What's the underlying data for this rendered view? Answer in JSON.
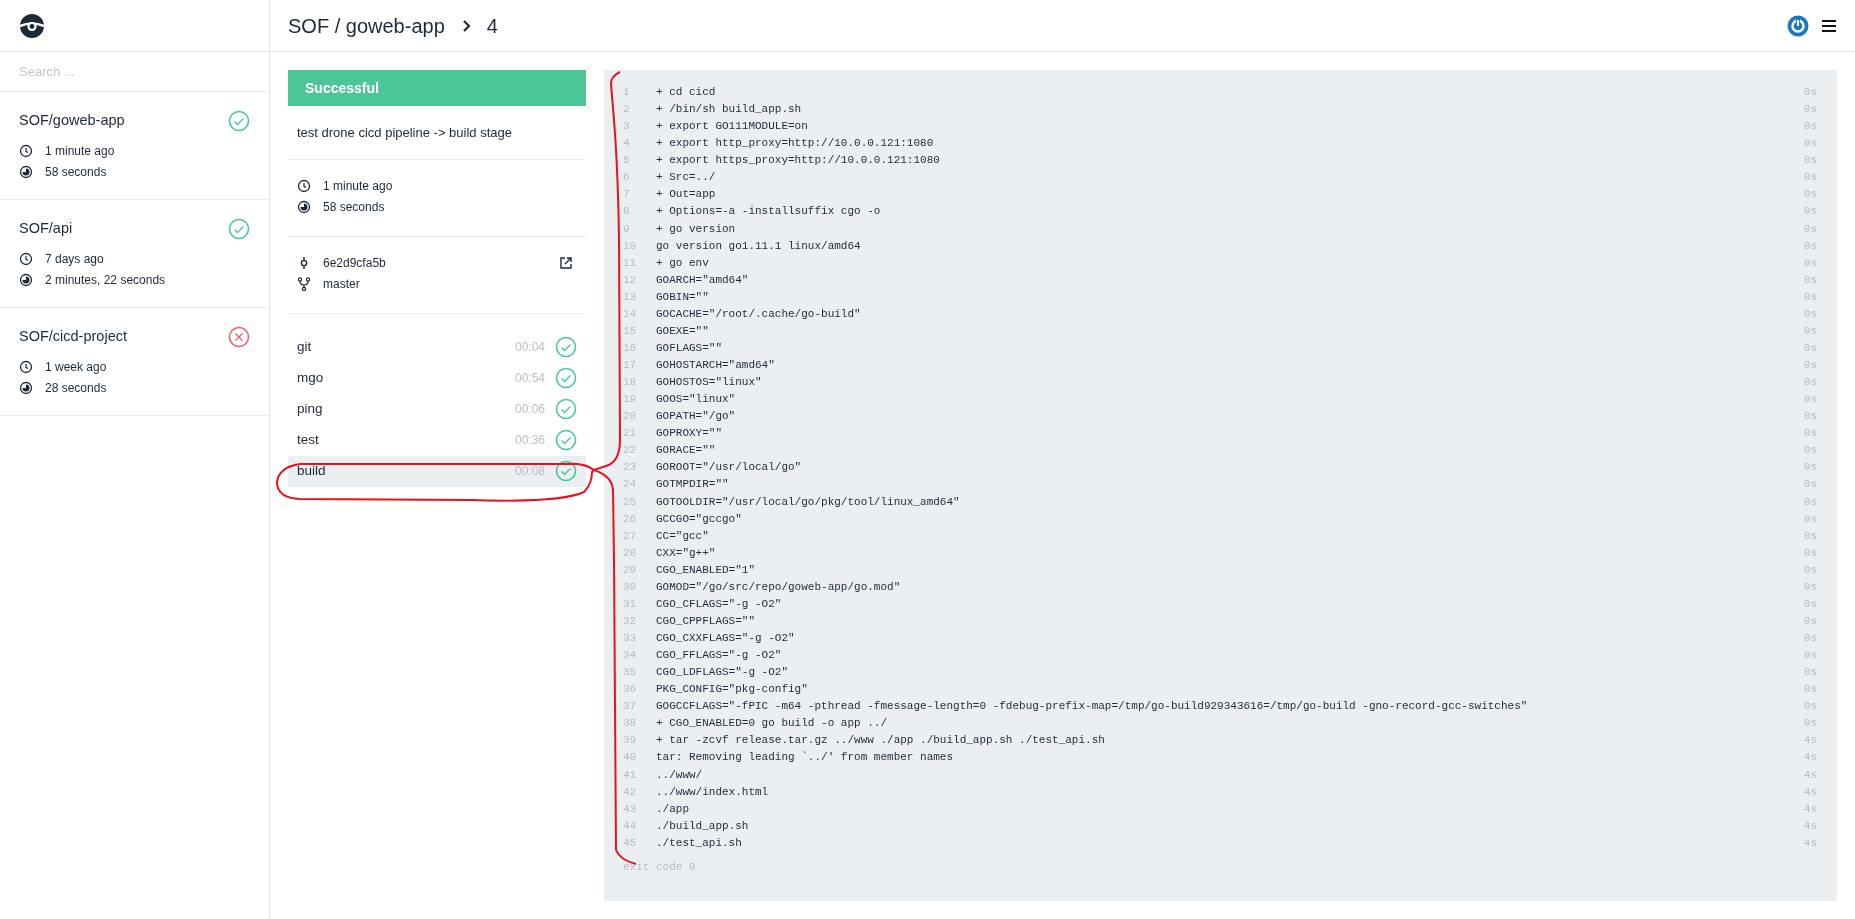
{
  "search": {
    "placeholder": "Search ..."
  },
  "repos": [
    {
      "name": "SOF/goweb-app",
      "kind": "success",
      "created": "1 minute ago",
      "duration": "58 seconds"
    },
    {
      "name": "SOF/api",
      "kind": "success",
      "created": "7 days ago",
      "duration": "2 minutes, 22 seconds"
    },
    {
      "name": "SOF/cicd-project",
      "kind": "failure",
      "created": "1 week ago",
      "duration": "28 seconds"
    }
  ],
  "header": {
    "breadcrumb": "SOF / goweb-app",
    "build_number": "4"
  },
  "build": {
    "kind": "success",
    "status_label": "Successful",
    "message": "test drone cicd pipeline -> build stage",
    "created": "1 minute ago",
    "duration": "58 seconds",
    "commit": "6e2d9cfa5b",
    "branch": "master"
  },
  "steps": [
    {
      "name": "git",
      "duration": "00:04",
      "kind": "success",
      "selected": false
    },
    {
      "name": "mgo",
      "duration": "00:54",
      "kind": "success",
      "selected": false
    },
    {
      "name": "ping",
      "duration": "00:06",
      "kind": "success",
      "selected": false
    },
    {
      "name": "test",
      "duration": "00:36",
      "kind": "success",
      "selected": false
    },
    {
      "name": "build",
      "duration": "00:08",
      "kind": "success",
      "selected": true
    }
  ],
  "log": {
    "lines": [
      {
        "number": "1",
        "text": "+ cd cicd",
        "time": "0s"
      },
      {
        "number": "2",
        "text": "+ /bin/sh build_app.sh",
        "time": "0s"
      },
      {
        "number": "3",
        "text": "+ export GO111MODULE=on",
        "time": "0s"
      },
      {
        "number": "4",
        "text": "+ export http_proxy=http://10.0.0.121:1080",
        "time": "0s"
      },
      {
        "number": "5",
        "text": "+ export https_proxy=http://10.0.0.121:1080",
        "time": "0s"
      },
      {
        "number": "6",
        "text": "+ Src=../",
        "time": "0s"
      },
      {
        "number": "7",
        "text": "+ Out=app",
        "time": "0s"
      },
      {
        "number": "8",
        "text": "+ Options=-a -installsuffix cgo -o",
        "time": "0s"
      },
      {
        "number": "9",
        "text": "+ go version",
        "time": "0s"
      },
      {
        "number": "10",
        "text": "go version go1.11.1 linux/amd64",
        "time": "0s"
      },
      {
        "number": "11",
        "text": "+ go env",
        "time": "0s"
      },
      {
        "number": "12",
        "text": "GOARCH=\"amd64\"",
        "time": "0s"
      },
      {
        "number": "13",
        "text": "GOBIN=\"\"",
        "time": "0s"
      },
      {
        "number": "14",
        "text": "GOCACHE=\"/root/.cache/go-build\"",
        "time": "0s"
      },
      {
        "number": "15",
        "text": "GOEXE=\"\"",
        "time": "0s"
      },
      {
        "number": "16",
        "text": "GOFLAGS=\"\"",
        "time": "0s"
      },
      {
        "number": "17",
        "text": "GOHOSTARCH=\"amd64\"",
        "time": "0s"
      },
      {
        "number": "18",
        "text": "GOHOSTOS=\"linux\"",
        "time": "0s"
      },
      {
        "number": "19",
        "text": "GOOS=\"linux\"",
        "time": "0s"
      },
      {
        "number": "20",
        "text": "GOPATH=\"/go\"",
        "time": "0s"
      },
      {
        "number": "21",
        "text": "GOPROXY=\"\"",
        "time": "0s"
      },
      {
        "number": "22",
        "text": "GORACE=\"\"",
        "time": "0s"
      },
      {
        "number": "23",
        "text": "GOROOT=\"/usr/local/go\"",
        "time": "0s"
      },
      {
        "number": "24",
        "text": "GOTMPDIR=\"\"",
        "time": "0s"
      },
      {
        "number": "25",
        "text": "GOTOOLDIR=\"/usr/local/go/pkg/tool/linux_amd64\"",
        "time": "0s"
      },
      {
        "number": "26",
        "text": "GCCGO=\"gccgo\"",
        "time": "0s"
      },
      {
        "number": "27",
        "text": "CC=\"gcc\"",
        "time": "0s"
      },
      {
        "number": "28",
        "text": "CXX=\"g++\"",
        "time": "0s"
      },
      {
        "number": "29",
        "text": "CGO_ENABLED=\"1\"",
        "time": "0s"
      },
      {
        "number": "30",
        "text": "GOMOD=\"/go/src/repo/goweb-app/go.mod\"",
        "time": "0s"
      },
      {
        "number": "31",
        "text": "CGO_CFLAGS=\"-g -O2\"",
        "time": "0s"
      },
      {
        "number": "32",
        "text": "CGO_CPPFLAGS=\"\"",
        "time": "0s"
      },
      {
        "number": "33",
        "text": "CGO_CXXFLAGS=\"-g -O2\"",
        "time": "0s"
      },
      {
        "number": "34",
        "text": "CGO_FFLAGS=\"-g -O2\"",
        "time": "0s"
      },
      {
        "number": "35",
        "text": "CGO_LDFLAGS=\"-g -O2\"",
        "time": "0s"
      },
      {
        "number": "36",
        "text": "PKG_CONFIG=\"pkg-config\"",
        "time": "0s"
      },
      {
        "number": "37",
        "text": "GOGCCFLAGS=\"-fPIC -m64 -pthread -fmessage-length=0 -fdebug-prefix-map=/tmp/go-build929343616=/tmp/go-build -gno-record-gcc-switches\"",
        "time": "0s"
      },
      {
        "number": "38",
        "text": "+ CGO_ENABLED=0 go build -o app ../",
        "time": "0s"
      },
      {
        "number": "39",
        "text": "+ tar -zcvf release.tar.gz ../www ./app ./build_app.sh ./test_api.sh",
        "time": "4s"
      },
      {
        "number": "40",
        "text": "tar: Removing leading `../' from member names",
        "time": "4s"
      },
      {
        "number": "41",
        "text": "../www/",
        "time": "4s"
      },
      {
        "number": "42",
        "text": "../www/index.html",
        "time": "4s"
      },
      {
        "number": "43",
        "text": "./app",
        "time": "4s"
      },
      {
        "number": "44",
        "text": "./build_app.sh",
        "time": "4s"
      },
      {
        "number": "45",
        "text": "./test_api.sh",
        "time": "4s"
      }
    ],
    "exit": "exit code 0"
  }
}
